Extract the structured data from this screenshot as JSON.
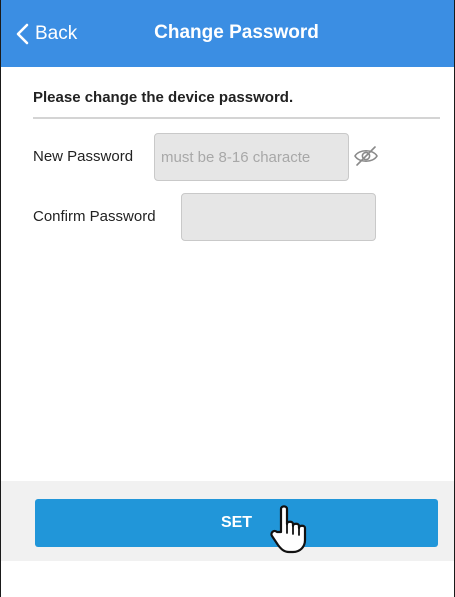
{
  "header": {
    "back_label": "Back",
    "title": "Change Password",
    "background_color": "#3b8ee3"
  },
  "main": {
    "instruction": "Please change the device password.",
    "new_password": {
      "label": "New Password",
      "placeholder": "must be 8-16 characte",
      "value": "",
      "visibility_icon": "eye-slash-icon"
    },
    "confirm_password": {
      "label": "Confirm Password",
      "placeholder": "",
      "value": ""
    }
  },
  "footer": {
    "set_label": "SET",
    "button_color": "#2196d9"
  },
  "cursor": {
    "icon": "hand-pointer-icon"
  }
}
